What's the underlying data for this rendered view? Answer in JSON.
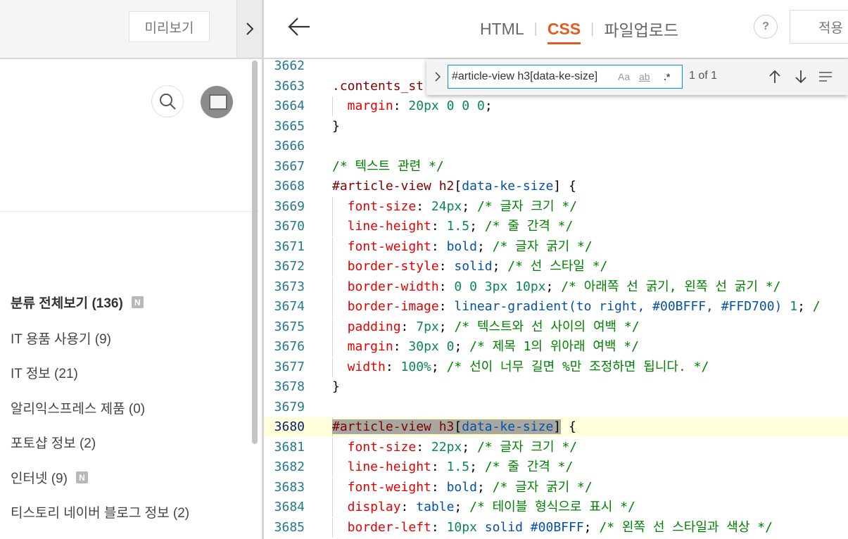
{
  "left_panel": {
    "preview_label": "미리보기",
    "categories": [
      {
        "label": "분류 전체보기 (136)",
        "badge": "N"
      },
      {
        "label": "IT 용품 사용기 (9)"
      },
      {
        "label": "IT 정보 (21)"
      },
      {
        "label": "알리익스프레스 제품 (0)"
      },
      {
        "label": "포토샵 정보 (2)"
      },
      {
        "label": "인터넷 (9)",
        "badge": "N"
      },
      {
        "label": "티스토리 네이버 블로그 정보 (2)"
      }
    ]
  },
  "header": {
    "tabs": [
      {
        "label": "HTML",
        "active": false
      },
      {
        "label": "CSS",
        "active": true
      },
      {
        "label": "파일업로드",
        "active": false
      }
    ],
    "tab_separator": "|",
    "help_label": "?",
    "apply_label": "적용"
  },
  "find": {
    "query": "#article-view h3[data-ke-size]",
    "match_case": "Aa",
    "whole_word": "ab",
    "regex": ".*",
    "count": "1 of 1"
  },
  "colors": {
    "accent": "#e55a1f",
    "line_number": "#237893",
    "selector": "#800000",
    "property": "#e50000",
    "number": "#098658",
    "value": "#0451a5",
    "comment": "#008000",
    "current_line": "#ffffdc"
  },
  "code": {
    "lines": [
      {
        "n": "3662",
        "t": []
      },
      {
        "n": "3663",
        "t": [
          {
            "c": "sel",
            "s": ".contents_st"
          }
        ]
      },
      {
        "n": "3664",
        "g": true,
        "t": [
          {
            "c": "prop",
            "s": "  margin"
          },
          {
            "c": "punc",
            "s": ": "
          },
          {
            "c": "num",
            "s": "20px"
          },
          {
            "c": "punc",
            "s": " "
          },
          {
            "c": "num",
            "s": "0"
          },
          {
            "c": "punc",
            "s": " "
          },
          {
            "c": "num",
            "s": "0"
          },
          {
            "c": "punc",
            "s": " "
          },
          {
            "c": "num",
            "s": "0"
          },
          {
            "c": "punc",
            "s": ";"
          }
        ]
      },
      {
        "n": "3665",
        "t": [
          {
            "c": "punc",
            "s": "}"
          }
        ]
      },
      {
        "n": "3666",
        "t": []
      },
      {
        "n": "3667",
        "t": [
          {
            "c": "cmt",
            "s": "/* 텍스트 관련 */"
          }
        ]
      },
      {
        "n": "3668",
        "t": [
          {
            "c": "sel",
            "s": "#article-view h2"
          },
          {
            "c": "punc",
            "s": "["
          },
          {
            "c": "attr",
            "s": "data-ke-size"
          },
          {
            "c": "punc",
            "s": "] {"
          }
        ]
      },
      {
        "n": "3669",
        "g": true,
        "t": [
          {
            "c": "prop",
            "s": "  font-size"
          },
          {
            "c": "punc",
            "s": ": "
          },
          {
            "c": "num",
            "s": "24px"
          },
          {
            "c": "punc",
            "s": "; "
          },
          {
            "c": "cmt",
            "s": "/* 글자 크기 */"
          }
        ]
      },
      {
        "n": "3670",
        "g": true,
        "t": [
          {
            "c": "prop",
            "s": "  line-height"
          },
          {
            "c": "punc",
            "s": ": "
          },
          {
            "c": "num",
            "s": "1.5"
          },
          {
            "c": "punc",
            "s": "; "
          },
          {
            "c": "cmt",
            "s": "/* 줄 간격 */"
          }
        ]
      },
      {
        "n": "3671",
        "g": true,
        "t": [
          {
            "c": "prop",
            "s": "  font-weight"
          },
          {
            "c": "punc",
            "s": ": "
          },
          {
            "c": "val",
            "s": "bold"
          },
          {
            "c": "punc",
            "s": "; "
          },
          {
            "c": "cmt",
            "s": "/* 글자 굵기 */"
          }
        ]
      },
      {
        "n": "3672",
        "g": true,
        "t": [
          {
            "c": "prop",
            "s": "  border-style"
          },
          {
            "c": "punc",
            "s": ": "
          },
          {
            "c": "val",
            "s": "solid"
          },
          {
            "c": "punc",
            "s": "; "
          },
          {
            "c": "cmt",
            "s": "/* 선 스타일 */"
          }
        ]
      },
      {
        "n": "3673",
        "g": true,
        "t": [
          {
            "c": "prop",
            "s": "  border-width"
          },
          {
            "c": "punc",
            "s": ": "
          },
          {
            "c": "num",
            "s": "0"
          },
          {
            "c": "punc",
            "s": " "
          },
          {
            "c": "num",
            "s": "0"
          },
          {
            "c": "punc",
            "s": " "
          },
          {
            "c": "num",
            "s": "3px"
          },
          {
            "c": "punc",
            "s": " "
          },
          {
            "c": "num",
            "s": "10px"
          },
          {
            "c": "punc",
            "s": "; "
          },
          {
            "c": "cmt",
            "s": "/* 아래쪽 선 굵기, 왼쪽 선 굵기 */"
          }
        ]
      },
      {
        "n": "3674",
        "g": true,
        "t": [
          {
            "c": "prop",
            "s": "  border-image"
          },
          {
            "c": "punc",
            "s": ": "
          },
          {
            "c": "val",
            "s": "linear-gradient(to right, #00BFFF, #FFD700)"
          },
          {
            "c": "punc",
            "s": " "
          },
          {
            "c": "num",
            "s": "1"
          },
          {
            "c": "punc",
            "s": "; "
          },
          {
            "c": "cmt",
            "s": "/"
          }
        ]
      },
      {
        "n": "3675",
        "g": true,
        "t": [
          {
            "c": "prop",
            "s": "  padding"
          },
          {
            "c": "punc",
            "s": ": "
          },
          {
            "c": "num",
            "s": "7px"
          },
          {
            "c": "punc",
            "s": "; "
          },
          {
            "c": "cmt",
            "s": "/* 텍스트와 선 사이의 여백 */"
          }
        ]
      },
      {
        "n": "3676",
        "g": true,
        "t": [
          {
            "c": "prop",
            "s": "  margin"
          },
          {
            "c": "punc",
            "s": ": "
          },
          {
            "c": "num",
            "s": "30px"
          },
          {
            "c": "punc",
            "s": " "
          },
          {
            "c": "num",
            "s": "0"
          },
          {
            "c": "punc",
            "s": "; "
          },
          {
            "c": "cmt",
            "s": "/* 제목 1의 위아래 여백 */"
          }
        ]
      },
      {
        "n": "3677",
        "g": true,
        "t": [
          {
            "c": "prop",
            "s": "  width"
          },
          {
            "c": "punc",
            "s": ": "
          },
          {
            "c": "num",
            "s": "100%"
          },
          {
            "c": "punc",
            "s": "; "
          },
          {
            "c": "cmt",
            "s": "/* 선이 너무 길면 %만 조정하면 됩니다. */"
          }
        ]
      },
      {
        "n": "3678",
        "t": [
          {
            "c": "punc",
            "s": "}"
          }
        ]
      },
      {
        "n": "3679",
        "t": []
      },
      {
        "n": "3680",
        "hl": true,
        "t": [
          {
            "c": "sel sel-hl",
            "s": "#article-view h3"
          },
          {
            "c": "punc sel-hl",
            "s": "["
          },
          {
            "c": "attr sel-hl",
            "s": "data-ke-size"
          },
          {
            "c": "punc sel-hl",
            "s": "]"
          },
          {
            "c": "punc",
            "s": " {"
          }
        ]
      },
      {
        "n": "3681",
        "g": true,
        "t": [
          {
            "c": "prop",
            "s": "  font-size"
          },
          {
            "c": "punc",
            "s": ": "
          },
          {
            "c": "num",
            "s": "22px"
          },
          {
            "c": "punc",
            "s": "; "
          },
          {
            "c": "cmt",
            "s": "/* 글자 크기 */"
          }
        ]
      },
      {
        "n": "3682",
        "g": true,
        "t": [
          {
            "c": "prop",
            "s": "  line-height"
          },
          {
            "c": "punc",
            "s": ": "
          },
          {
            "c": "num",
            "s": "1.5"
          },
          {
            "c": "punc",
            "s": "; "
          },
          {
            "c": "cmt",
            "s": "/* 줄 간격 */"
          }
        ]
      },
      {
        "n": "3683",
        "g": true,
        "t": [
          {
            "c": "prop",
            "s": "  font-weight"
          },
          {
            "c": "punc",
            "s": ": "
          },
          {
            "c": "val",
            "s": "bold"
          },
          {
            "c": "punc",
            "s": "; "
          },
          {
            "c": "cmt",
            "s": "/* 글자 굵기 */"
          }
        ]
      },
      {
        "n": "3684",
        "g": true,
        "t": [
          {
            "c": "prop",
            "s": "  display"
          },
          {
            "c": "punc",
            "s": ": "
          },
          {
            "c": "val",
            "s": "table"
          },
          {
            "c": "punc",
            "s": "; "
          },
          {
            "c": "cmt",
            "s": "/* 테이블 형식으로 표시 */"
          }
        ]
      },
      {
        "n": "3685",
        "g": true,
        "t": [
          {
            "c": "prop",
            "s": "  border-left"
          },
          {
            "c": "punc",
            "s": ": "
          },
          {
            "c": "num",
            "s": "10px"
          },
          {
            "c": "punc",
            "s": " "
          },
          {
            "c": "val",
            "s": "solid #00BFFF"
          },
          {
            "c": "punc",
            "s": "; "
          },
          {
            "c": "cmt",
            "s": "/* 왼쪽 선 스타일과 색상 */"
          }
        ]
      }
    ]
  }
}
